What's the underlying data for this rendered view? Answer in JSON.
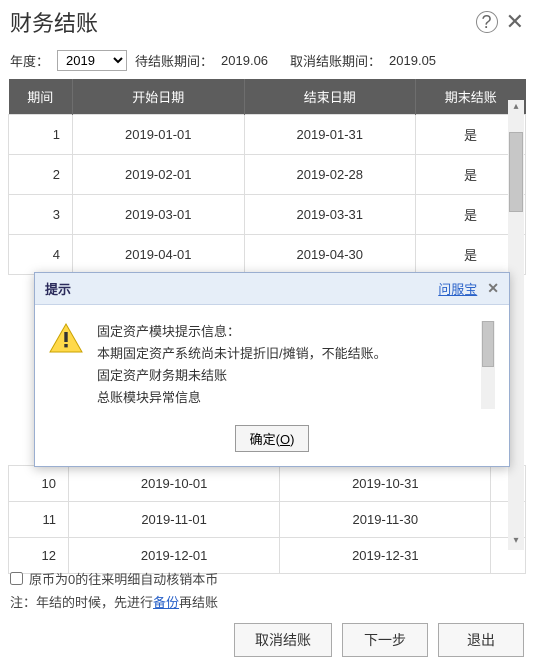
{
  "title": "财务结账",
  "filter": {
    "year_label": "年度：",
    "year_value": "2019",
    "pending_label": "待结账期间：",
    "pending_value": "2019.06",
    "cancel_label": "取消结账期间：",
    "cancel_value": "2019.05"
  },
  "table": {
    "headers": [
      "期间",
      "开始日期",
      "结束日期",
      "期末结账"
    ],
    "rows": [
      {
        "period": "1",
        "start": "2019-01-01",
        "end": "2019-01-31",
        "closed": "是"
      },
      {
        "period": "2",
        "start": "2019-02-01",
        "end": "2019-02-28",
        "closed": "是"
      },
      {
        "period": "3",
        "start": "2019-03-01",
        "end": "2019-03-31",
        "closed": "是"
      },
      {
        "period": "4",
        "start": "2019-04-01",
        "end": "2019-04-30",
        "closed": "是"
      },
      {
        "period": "10",
        "start": "2019-10-01",
        "end": "2019-10-31",
        "closed": ""
      },
      {
        "period": "11",
        "start": "2019-11-01",
        "end": "2019-11-30",
        "closed": ""
      },
      {
        "period": "12",
        "start": "2019-12-01",
        "end": "2019-12-31",
        "closed": ""
      }
    ]
  },
  "modal": {
    "title": "提示",
    "service_link": "问服宝",
    "lines": [
      "固定资产模块提示信息：",
      "本期固定资产系统尚未计提折旧/摊销，不能结账。",
      "固定资产财务期未结账",
      "总账模块异常信息"
    ],
    "ok_label": "确定(",
    "ok_key": "O",
    "ok_tail": ")"
  },
  "footer": {
    "checkbox_label": "原币为0的往来明细自动核销本币",
    "note_prefix": "注：年结的时候，先进行",
    "note_link": "备份",
    "note_suffix": "再结账",
    "buttons": {
      "cancel_close": "取消结账",
      "next": "下一步",
      "exit": "退出"
    }
  }
}
